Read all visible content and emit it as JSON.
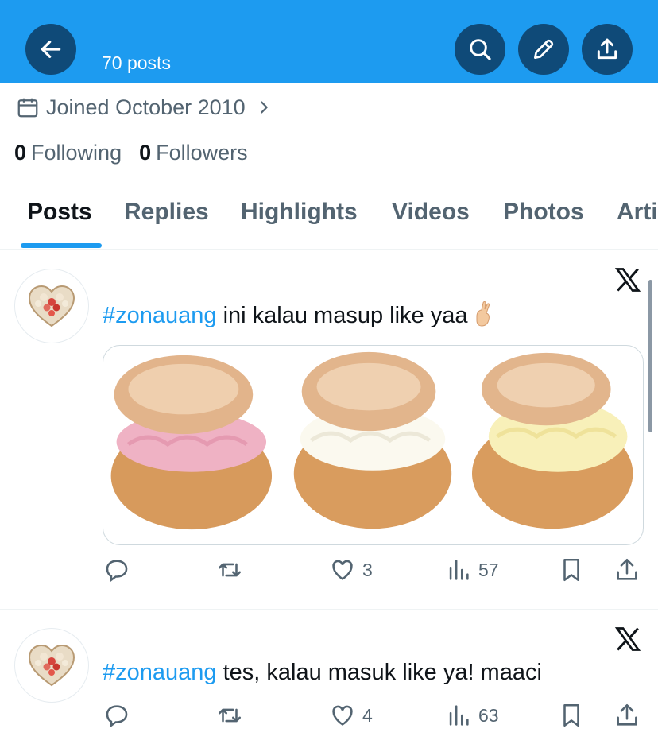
{
  "header": {
    "posts_count": "70 posts",
    "back_icon": "arrow-left-icon",
    "search_icon": "search-icon",
    "edit_icon": "pencil-icon",
    "share_icon": "share-icon",
    "bg_color": "#1d9bf0",
    "button_color": "#0f4a78"
  },
  "profile": {
    "joined": "Joined October 2010",
    "following_count": "0",
    "following_label": "Following",
    "followers_count": "0",
    "followers_label": "Followers"
  },
  "tabs": [
    {
      "label": "Posts",
      "active": true
    },
    {
      "label": "Replies"
    },
    {
      "label": "Highlights"
    },
    {
      "label": "Videos"
    },
    {
      "label": "Photos"
    },
    {
      "label": "Arti"
    }
  ],
  "posts": [
    {
      "hashtag": "#zonauang",
      "text": " ini kalau masup like yaa",
      "emoji": "crossed-fingers",
      "media": "cream-puffs-image",
      "reply_count": "",
      "repost_count": "",
      "like_count": "3",
      "view_count": "57"
    },
    {
      "hashtag": "#zonauang",
      "text": " tes, kalau masuk like ya! maaci",
      "reply_count": "",
      "repost_count": "",
      "like_count": "4",
      "view_count": "63"
    }
  ],
  "colors": {
    "accent": "#1d9bf0",
    "muted": "#536471",
    "text": "#0f1419"
  }
}
